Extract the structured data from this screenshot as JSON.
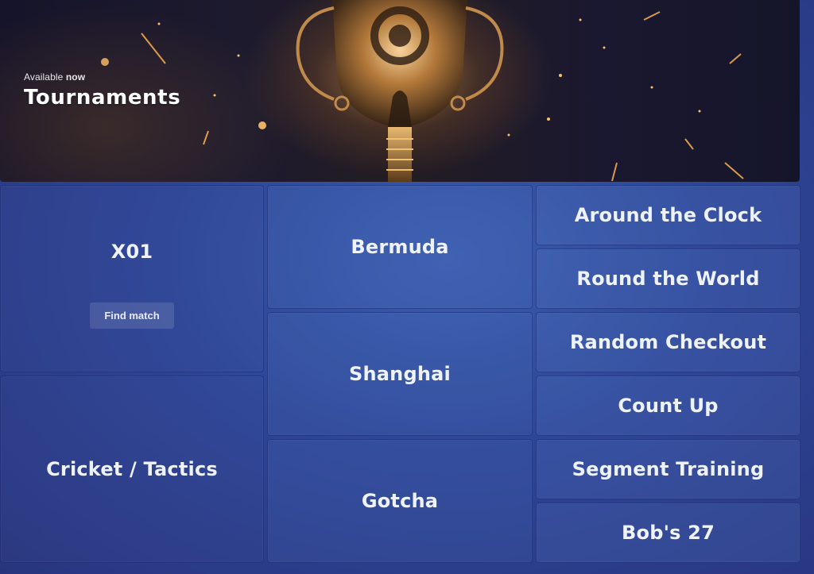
{
  "banner": {
    "availability_prefix": "Available",
    "availability_emphasis": "now",
    "title": "Tournaments"
  },
  "games": {
    "x01": {
      "label": "X01",
      "button_label": "Find match"
    },
    "cricket": {
      "label": "Cricket / Tactics"
    },
    "bermuda": {
      "label": "Bermuda"
    },
    "shanghai": {
      "label": "Shanghai"
    },
    "gotcha": {
      "label": "Gotcha"
    },
    "around_the_clock": {
      "label": "Around the Clock"
    },
    "round_the_world": {
      "label": "Round the World"
    },
    "random_checkout": {
      "label": "Random Checkout"
    },
    "count_up": {
      "label": "Count Up"
    },
    "segment_training": {
      "label": "Segment Training"
    },
    "bobs_27": {
      "label": "Bob's 27"
    }
  },
  "colors": {
    "background": "#2d4596",
    "banner_dark": "#1d1a2e",
    "glow": "#ffba5a",
    "text": "#eef2fb"
  }
}
